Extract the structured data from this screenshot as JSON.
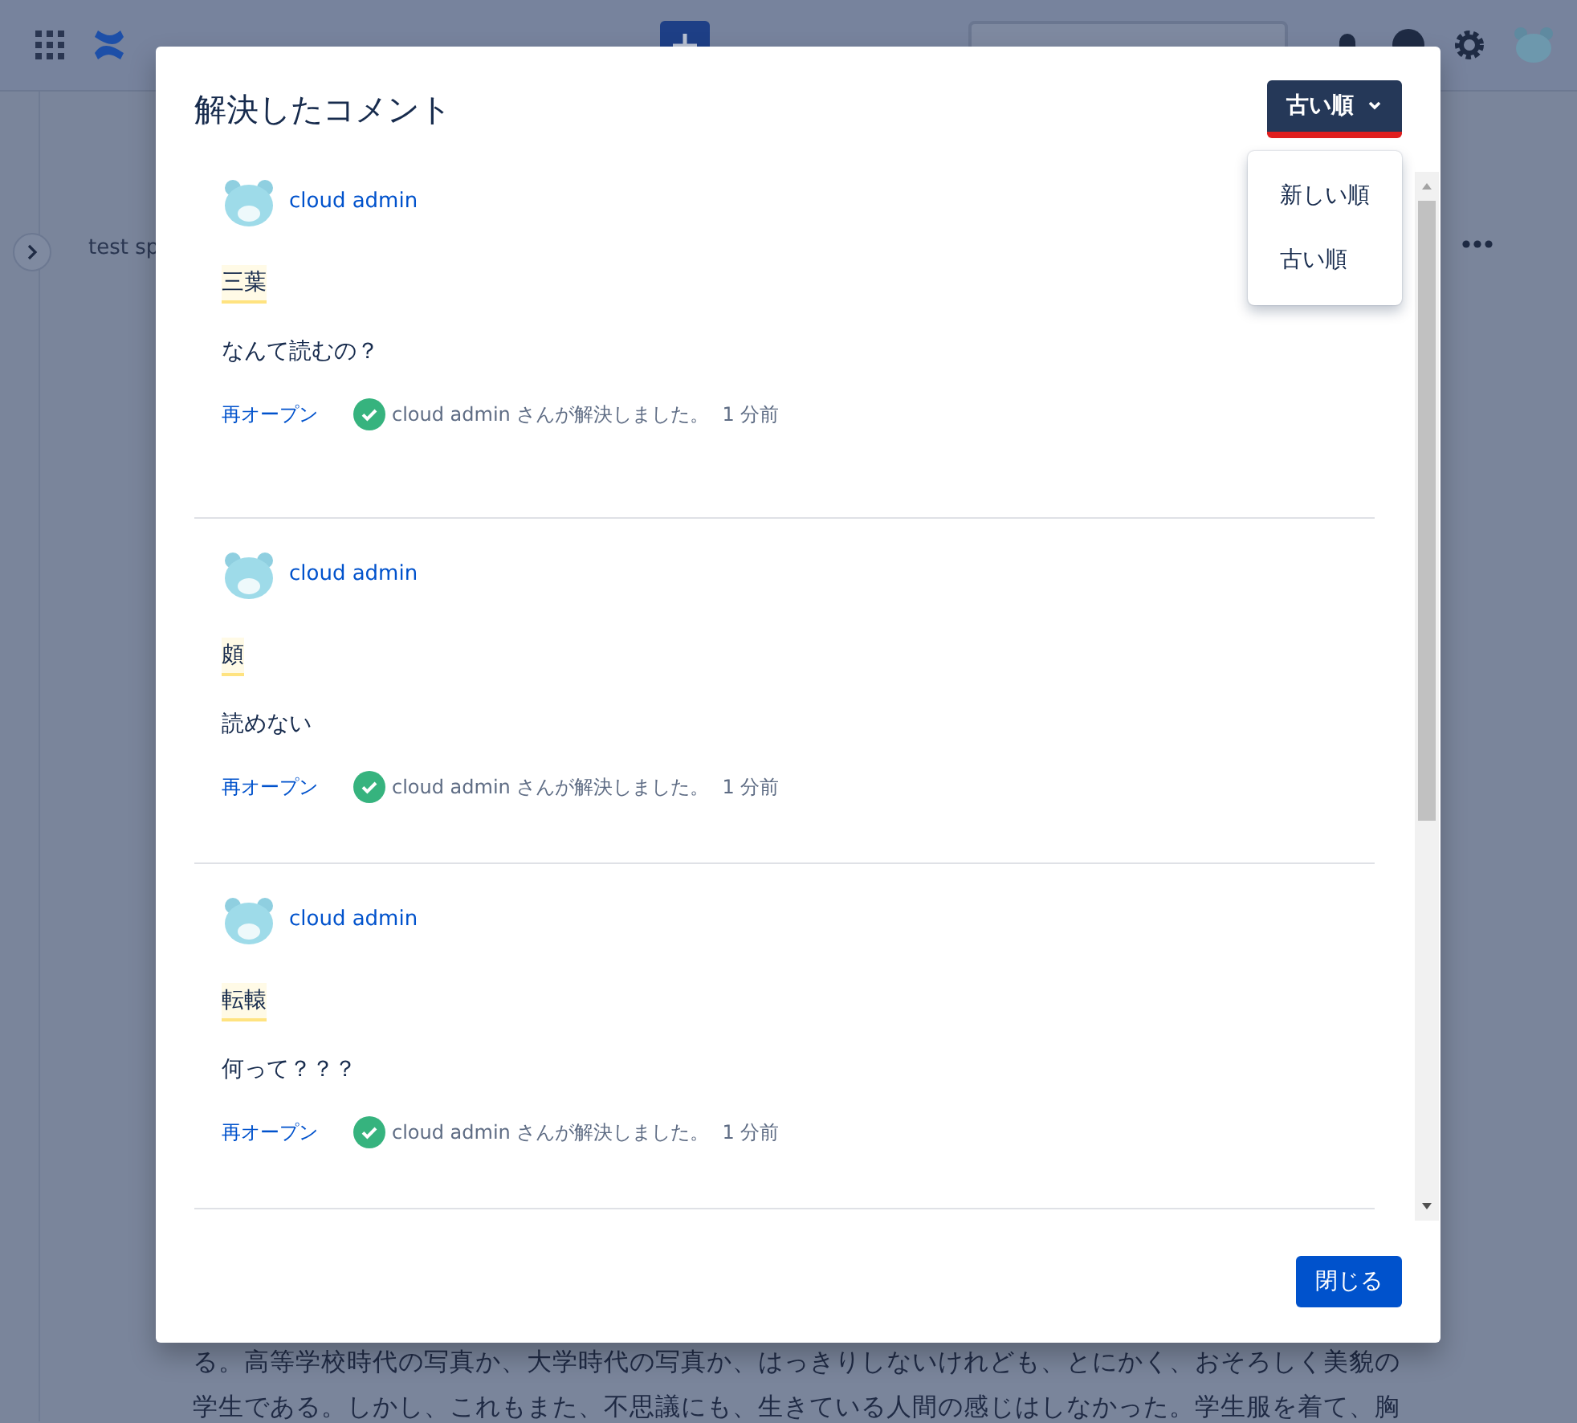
{
  "background": {
    "page_title": "test sp",
    "body_lines": [
      "る。高等学校時代の写真か、大学時代の写真か、はっきりしないけれども、とにかく、おそろしく美貌の",
      "学生である。しかし、これもまた、不思議にも、生きている人間の感じはしなかった。学生服を着て、胸"
    ]
  },
  "dialog": {
    "title": "解決したコメント",
    "sort": {
      "label": "古い順",
      "expanded": true,
      "options": [
        "新しい順",
        "古い順"
      ]
    },
    "comments": [
      {
        "author": "cloud admin",
        "highlight": "三葉",
        "text": "なんて読むの？",
        "reopen": "再オープン",
        "resolved": "cloud admin さんが解決しました。",
        "time": "1 分前"
      },
      {
        "author": "cloud admin",
        "highlight": "頗",
        "text": "読めない",
        "reopen": "再オープン",
        "resolved": "cloud admin さんが解決しました。",
        "time": "1 分前"
      },
      {
        "author": "cloud admin",
        "highlight": "転轅",
        "text": "何って？？？",
        "reopen": "再オープン",
        "resolved": "cloud admin さんが解決しました。",
        "time": "1 分前"
      }
    ],
    "close_button": "閉じる"
  }
}
